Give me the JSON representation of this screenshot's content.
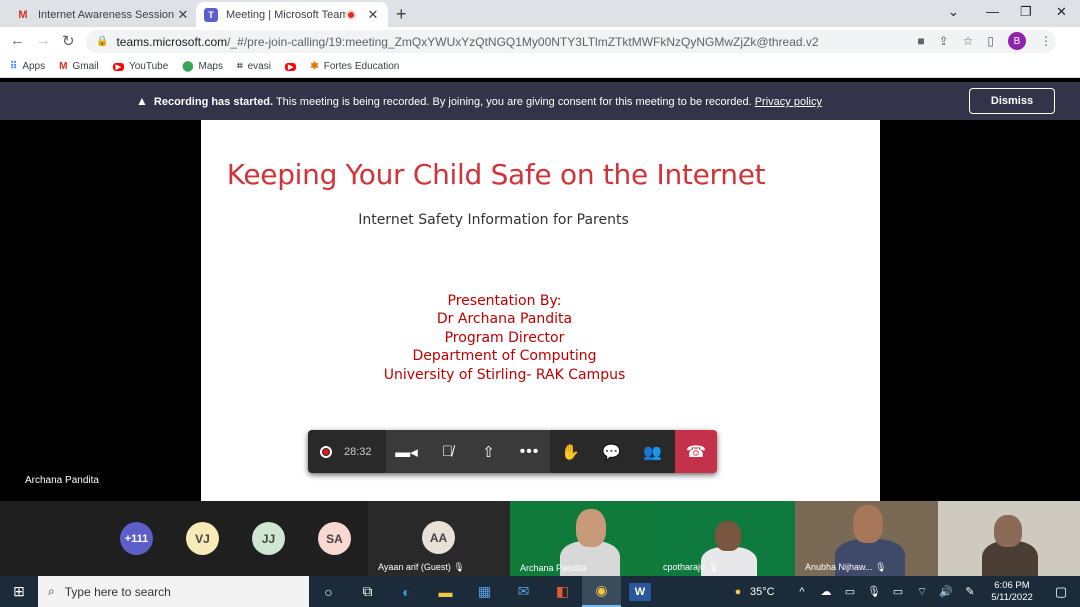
{
  "browser": {
    "tabs": [
      {
        "title": "Internet Awareness Session for Pa",
        "icon": "gmail-icon"
      },
      {
        "title": "Meeting | Microsoft Teams",
        "icon": "teams-icon",
        "active": true
      }
    ],
    "url_host": "teams.microsoft.com",
    "url_path": "/_#/pre-join-calling/19:meeting_ZmQxYWUxYzQtNGQ1My00NTY3LTlmZTktMWFkNzQyNGMwZjZk@thread.v2",
    "profile_initial": "B",
    "bookmarks": [
      "Apps",
      "Gmail",
      "YouTube",
      "Maps",
      "evasi",
      "",
      "Fortes Education"
    ]
  },
  "banner": {
    "bold": "Recording has started.",
    "text": " This meeting is being recorded. By joining, you are giving consent for this meeting to be recorded. ",
    "link": "Privacy policy",
    "dismiss_label": "Dismiss"
  },
  "slide": {
    "title": "Keeping Your Child Safe on the Internet",
    "subtitle": "Internet Safety Information for Parents",
    "presented_by": "Presentation By:",
    "presenter": "Dr Archana Pandita",
    "role": "Program Director",
    "department": "Department of Computing",
    "university": "University of Stirling- RAK Campus",
    "title_color": "#d13438",
    "accent_color": "#c00000"
  },
  "presenter_label": "Archana Pandita",
  "toolbar": {
    "timer": "28:32",
    "hangup_color": "#c4314b"
  },
  "participants": {
    "overflow": "+111",
    "avatars": [
      {
        "initials": "VJ",
        "color": "#f8e9b8"
      },
      {
        "initials": "JJ",
        "color": "#cfe6d2"
      },
      {
        "initials": "SA",
        "color": "#f9d8d2"
      }
    ],
    "tiles": [
      {
        "initials": "AA",
        "name": "Ayaan arif (Guest)"
      },
      {
        "name": "Archana Pandita"
      },
      {
        "name": "cpotharaju"
      },
      {
        "name": "Anubha Nijhaw..."
      }
    ]
  },
  "taskbar": {
    "search_placeholder": "Type here to search",
    "temperature": "35°C",
    "time": "6:06 PM",
    "date": "5/11/2022"
  }
}
